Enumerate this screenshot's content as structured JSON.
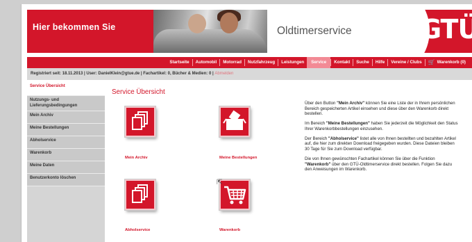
{
  "header": {
    "banner_text": "Hier bekommen Sie",
    "service_title": "Oldtimerservice",
    "logo_text": "GTÜ"
  },
  "nav": {
    "items": [
      {
        "label": "Startseite"
      },
      {
        "label": "Automobil"
      },
      {
        "label": "Motorrad"
      },
      {
        "label": "Nutzfahrzeug"
      },
      {
        "label": "Leistungen"
      },
      {
        "label": "Service",
        "active": true
      },
      {
        "label": "Kontakt"
      },
      {
        "label": "Suche"
      },
      {
        "label": "Hilfe"
      },
      {
        "label": "Vereine / Clubs"
      }
    ],
    "cart_label": "Warenkorb (0)"
  },
  "userbar": {
    "text": "Registriert seit: 18.11.2013 | User: DanielKlein@gtue.de | Fachartikel: 0, Bücher & Medien: 0 |",
    "logout_label": "Abmelden"
  },
  "sidebar": {
    "items": [
      {
        "label": "Service Übersicht",
        "active": true
      },
      {
        "label": "Nutzungs- und Lieferungsbedingungen"
      },
      {
        "label": "Mein Archiv"
      },
      {
        "label": "Meine Bestellungen"
      },
      {
        "label": "Abholservice"
      },
      {
        "label": "Warenkorb"
      },
      {
        "label": "Meine Daten"
      },
      {
        "label": "Benutzerkonto löschen"
      }
    ]
  },
  "main": {
    "title": "Service Übersicht",
    "tiles": [
      {
        "label": "Mein Archiv",
        "icon": "archive-icon"
      },
      {
        "label": "Meine Bestellungen",
        "icon": "orders-icon"
      },
      {
        "label": "Abholservice",
        "icon": "pickup-icon"
      },
      {
        "label": "Warenkorb",
        "icon": "cart-icon"
      }
    ]
  },
  "info": {
    "p1_a": "Über den Button ",
    "p1_b": "\"Mein Archiv\"",
    "p1_c": " können Sie eine Liste der in Ihrem persönlichen Bereich gespeicherten Artikel einsehen und diese über den Warenkorb direkt bestellen.",
    "p2_a": "Im Bereich ",
    "p2_b": "\"Meine Bestellungen\"",
    "p2_c": " haben Sie jederzeit die Möglichkeit den Status Ihrer Warenkorbbestellungen einzusehen.",
    "p3_a": "Der Bereich ",
    "p3_b": "\"Abholservice\"",
    "p3_c": " listet alle von Ihnen bestellten und bezahlten Artikel auf, die hier zum direkten Download freigegeben wurden. Diese Dateien bleiben 30 Tage für Sie zum Download verfügbar.",
    "p4_a": "Die von Ihnen gewünschten Fachartikel können Sie über die Funktion ",
    "p4_b": "\"Warenkorb\"",
    "p4_c": " über den GTÜ-Oldtimerservice direkt bestellen. Folgen Sie dazu den Anweisungen im Warenkorb."
  },
  "colors": {
    "brand_red": "#d3162a",
    "nav_active": "#f28a95",
    "sidebar_grey": "#c9c9c9"
  }
}
